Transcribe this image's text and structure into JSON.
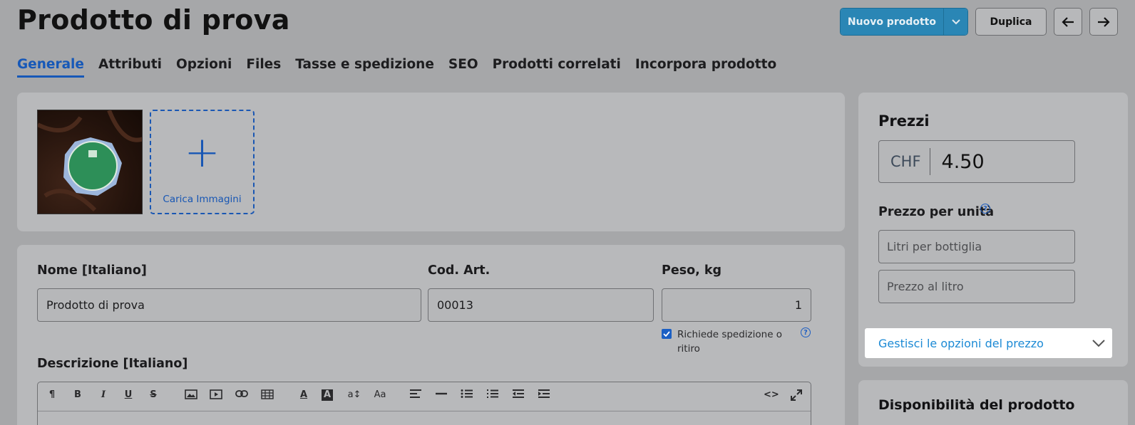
{
  "header": {
    "title": "Prodotto di prova",
    "new_product_label": "Nuovo prodotto",
    "duplicate_label": "Duplica"
  },
  "tabs": [
    {
      "label": "Generale",
      "active": true
    },
    {
      "label": "Attributi"
    },
    {
      "label": "Opzioni"
    },
    {
      "label": "Files"
    },
    {
      "label": "Tasse e spedizione"
    },
    {
      "label": "SEO"
    },
    {
      "label": "Prodotti correlati"
    },
    {
      "label": "Incorpora prodotto"
    }
  ],
  "images": {
    "upload_label": "Carica Immagini"
  },
  "form": {
    "name_label": "Nome [Italiano]",
    "name_value": "Prodotto di prova",
    "sku_label": "Cod. Art.",
    "sku_value": "00013",
    "weight_label": "Peso, kg",
    "weight_value": "1",
    "shipping_checkbox_label": "Richiede spedizione o ritiro",
    "shipping_checked": true,
    "description_label": "Descrizione [Italiano]"
  },
  "pricing": {
    "title": "Prezzi",
    "currency": "CHF",
    "price": "4.50",
    "unit_price_label": "Prezzo per unità",
    "unit_placeholder": "Litri per bottiglia",
    "per_liter_placeholder": "Prezzo al litro",
    "manage_options_label": "Gestisci le opzioni del prezzo"
  },
  "availability": {
    "title": "Disponibilità del prodotto"
  },
  "colors": {
    "accent": "#1658b8",
    "primary_button": "#2a86b5",
    "link": "#1c8ad5"
  }
}
